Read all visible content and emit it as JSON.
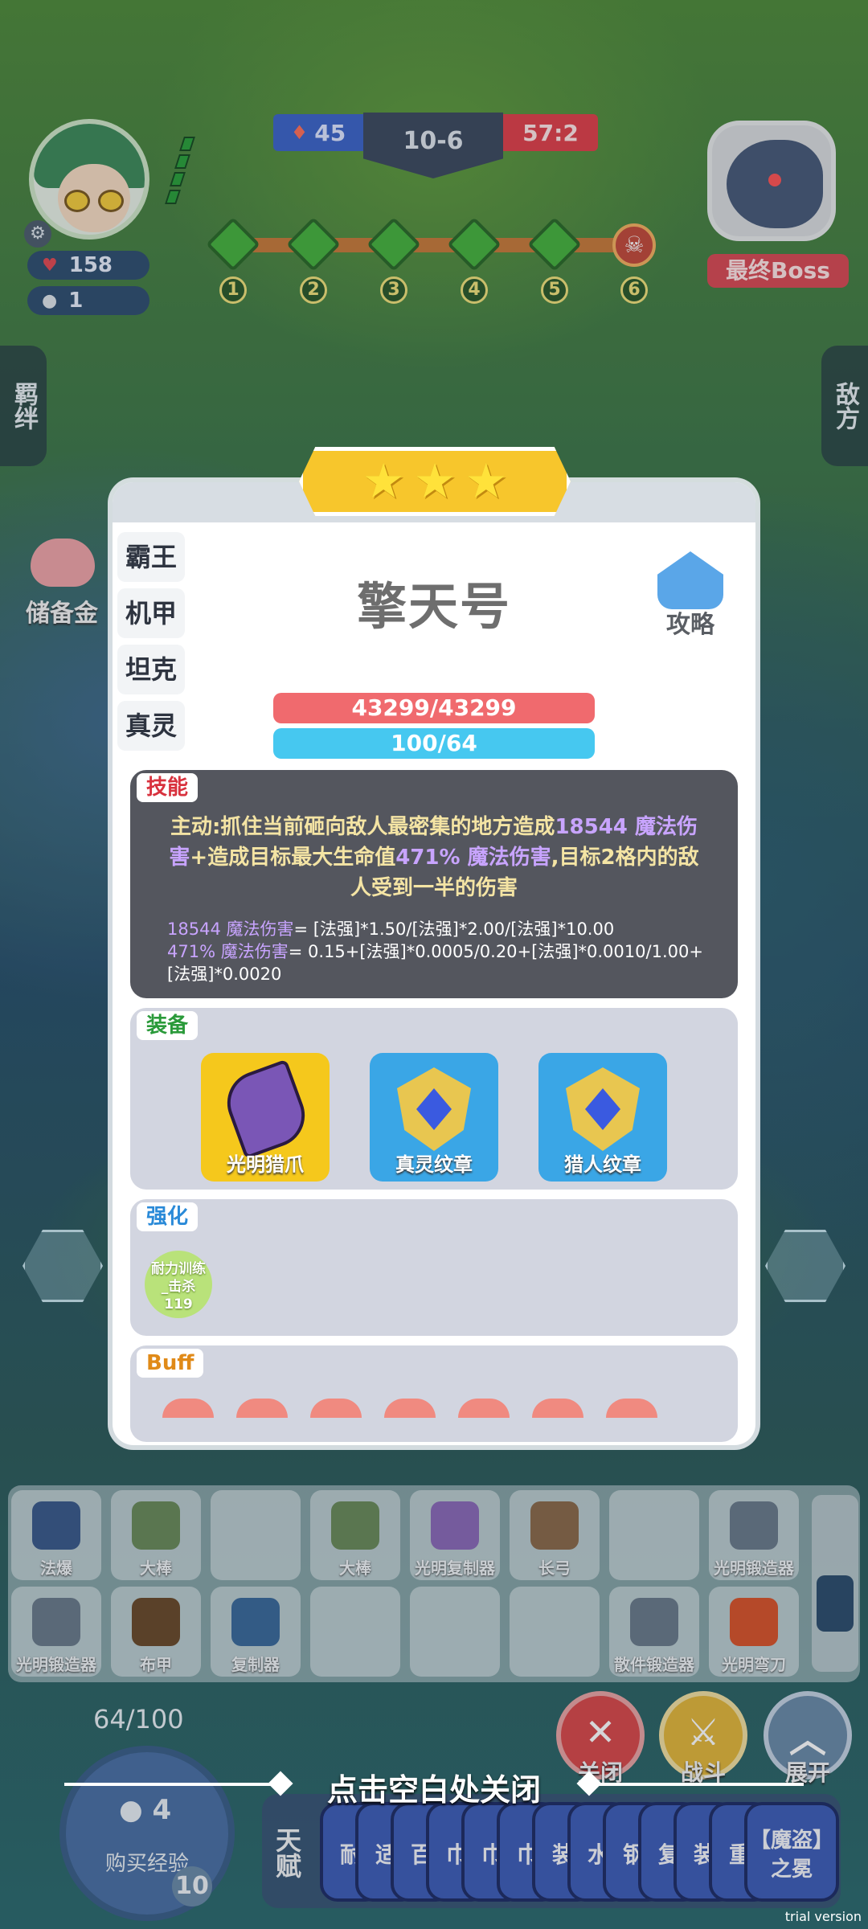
{
  "hud": {
    "hp": "158",
    "coins": "1",
    "score_left": "45",
    "stage": "10-6",
    "score_right": "57:2",
    "stage_nodes": [
      "1",
      "2",
      "3",
      "4",
      "5",
      "6"
    ],
    "boss_label": "最终Boss"
  },
  "side_tabs": {
    "left": "羁绊",
    "right": "敌方"
  },
  "savings_label": "储备金",
  "modal": {
    "stars": 3,
    "traits": [
      "霸王",
      "机甲",
      "坦克",
      "真灵"
    ],
    "hero_name": "擎天号",
    "guide_label": "攻略",
    "hp_bar": "43299/43299",
    "mp_bar": "100/64",
    "skill": {
      "tag": "技能",
      "desc_1": "主动:抓住当前砸向敌人最密集的地方造成",
      "desc_hl_1": "18544 魔法伤害",
      "desc_2": "+造成目标最大生命值",
      "desc_hl_2": "471% 魔法伤害",
      "desc_3": ",目标2格内的敌人受到一半的伤害",
      "formula_1_hl": "18544 魔法伤害",
      "formula_1": "= [法强]*1.50/[法强]*2.00/[法强]*10.00",
      "formula_2_hl": "471% 魔法伤害",
      "formula_2": "= 0.15+[法强]*0.0005/0.20+[法强]*0.0010/1.00+[法强]*0.0020"
    },
    "equip": {
      "tag": "装备",
      "items": [
        "光明猎爪",
        "真灵纹章",
        "猎人纹章"
      ]
    },
    "enhance": {
      "tag": "强化",
      "item_line1": "耐力训练",
      "item_line2": "_击杀",
      "item_line3": "119"
    },
    "buff": {
      "tag": "Buff"
    }
  },
  "bench": {
    "row1": [
      "法爆",
      "大棒",
      "",
      "大棒",
      "光明复制器",
      "长弓",
      "",
      "光明锻造器"
    ],
    "row2": [
      "光明锻造器",
      "布甲",
      "复制器",
      "",
      "",
      "",
      "散件锻造器",
      "光明弯刀"
    ]
  },
  "bottom": {
    "exp_progress": "64/100",
    "exp_coin": "4",
    "buy_exp": "购买经验",
    "level": "10",
    "close_btn": "关闭",
    "fight_btn": "战斗",
    "expand_btn": "展开",
    "close_hint": "点击空白处关闭",
    "talent_tag": "天赋",
    "talent_cards": [
      "耐",
      "适",
      "百",
      "巾",
      "巾",
      "巾",
      "装",
      "水",
      "钢",
      "复",
      "装",
      "重"
    ],
    "talent_last": "【魔盗】之冕",
    "trial": "trial version"
  },
  "colors": {
    "hp_bar": "#f06a6e",
    "mp_bar": "#46c8f0",
    "star": "#f7c62c",
    "skill_panel": "#54565e",
    "panel": "#d2d5e0"
  }
}
